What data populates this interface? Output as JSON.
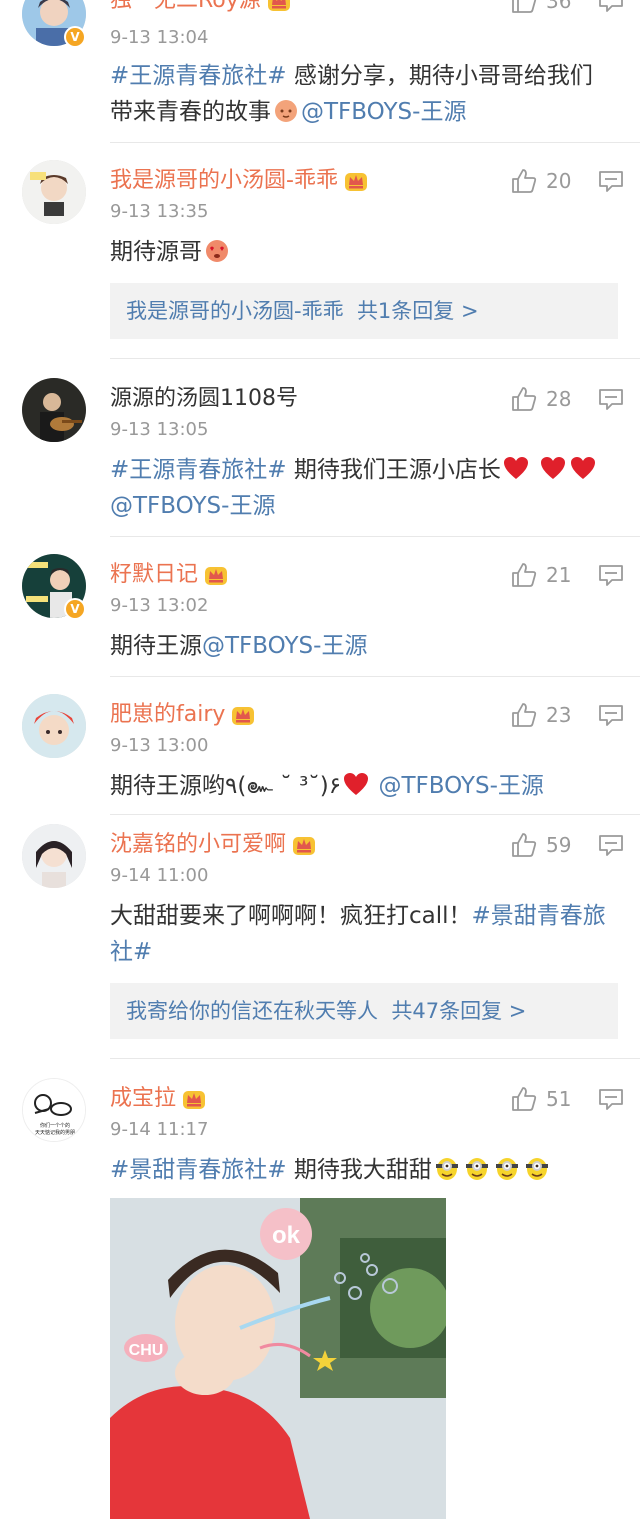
{
  "comments": [
    {
      "username": "独一无二Roy源",
      "time": "9-13 13:04",
      "likes": "36",
      "text": {
        "topic": "#王源青春旅社#",
        "body": " 感谢分享，期待小哥哥给我们带来青春的故事",
        "mention": "@TFBOYS-王源"
      }
    },
    {
      "username": "我是源哥的小汤圆-乖乖",
      "time": "9-13 13:35",
      "likes": "20",
      "text": {
        "body": "期待源哥"
      },
      "reply": {
        "name": "我是源哥的小汤圆-乖乖",
        "summary": "共1条回复 >"
      }
    },
    {
      "username": "源源的汤圆1108号",
      "time": "9-13 13:05",
      "likes": "28",
      "text": {
        "topic": "#王源青春旅社#",
        "body": " 期待我们王源小店长",
        "mention": "@TFBOYS-王源"
      }
    },
    {
      "username": "籽默日记",
      "time": "9-13 13:02",
      "likes": "21",
      "text": {
        "body": "期待王源",
        "mention": "@TFBOYS-王源"
      }
    },
    {
      "username": "肥崽的fairy",
      "time": "9-13 13:00",
      "likes": "23",
      "text": {
        "body": "期待王源哟٩(๛ ˘ ³˘)۶",
        "mention": "@TFBOYS-王源"
      }
    },
    {
      "username": "沈嘉铭的小可爱啊",
      "time": "9-14 11:00",
      "likes": "59",
      "text": {
        "body": "大甜甜要来了啊啊啊！疯狂打call！",
        "topic": "#景甜青春旅社#"
      },
      "reply": {
        "name": "我寄给你的信还在秋天等人",
        "summary": "共47条回复 >"
      }
    },
    {
      "username": "成宝拉",
      "time": "9-14 11:17",
      "likes": "51",
      "text": {
        "topic": "#景甜青春旅社#",
        "body": " 期待我大甜甜"
      },
      "avatar_text": [
        "你们一个个的",
        "天天惦记我的男朋"
      ],
      "photo_stickers": [
        "ok",
        "CHU"
      ]
    }
  ],
  "colors": {
    "vip_name": "#eb7350",
    "link": "#507daf",
    "meta": "#999999",
    "heart": "#e0202b"
  }
}
